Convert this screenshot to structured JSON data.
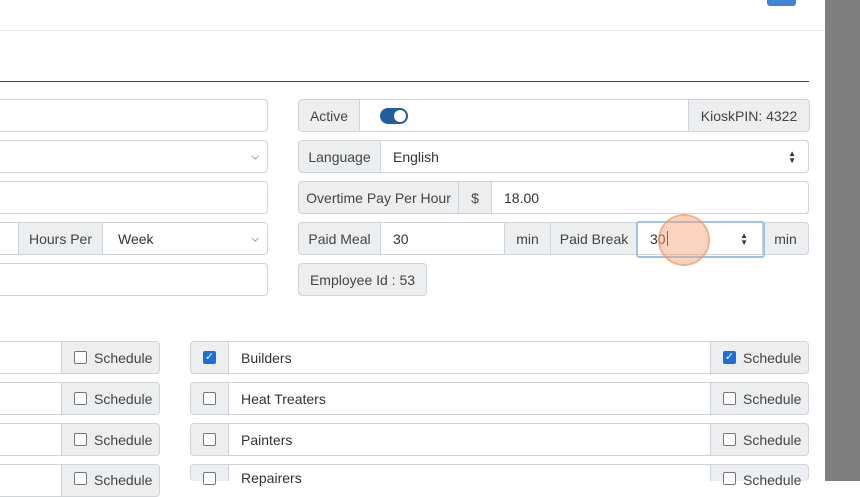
{
  "header": {
    "icon": "card-icon"
  },
  "left_form": {
    "hours_per_label": "Hours Per",
    "hours_per_value": "Week"
  },
  "right_form": {
    "active_label": "Active",
    "active_on": true,
    "kiosk_pin": "KioskPIN: 4322",
    "language_label": "Language",
    "language_value": "English",
    "overtime_label": "Overtime Pay Per Hour",
    "currency_symbol": "$",
    "overtime_value": "18.00",
    "paid_meal_label": "Paid Meal",
    "paid_meal_value": "30",
    "paid_meal_unit": "min",
    "paid_break_label": "Paid Break",
    "paid_break_value": "30",
    "paid_break_unit": "min",
    "employee_id": "Employee Id : 53"
  },
  "groups_left": [
    {
      "schedule_label": "Schedule",
      "schedule_checked": false
    },
    {
      "schedule_label": "Schedule",
      "schedule_checked": false
    },
    {
      "schedule_label": "Schedule",
      "schedule_checked": false
    },
    {
      "schedule_label": "Schedule",
      "schedule_checked": false
    }
  ],
  "groups_right": [
    {
      "name": "Builders",
      "checked": true,
      "schedule_label": "Schedule",
      "schedule_checked": true
    },
    {
      "name": "Heat Treaters",
      "checked": false,
      "schedule_label": "Schedule",
      "schedule_checked": false
    },
    {
      "name": "Painters",
      "checked": false,
      "schedule_label": "Schedule",
      "schedule_checked": false
    },
    {
      "name": "Repairers",
      "checked": false,
      "schedule_label": "Schedule",
      "schedule_checked": false
    }
  ]
}
